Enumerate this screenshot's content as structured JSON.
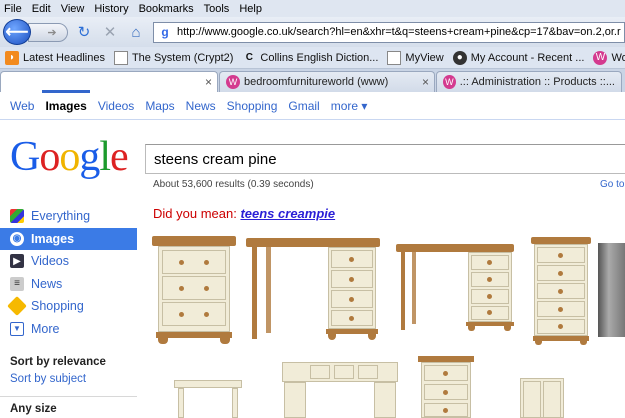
{
  "menu": [
    "File",
    "Edit",
    "View",
    "History",
    "Bookmarks",
    "Tools",
    "Help"
  ],
  "nav": {
    "url": "http://www.google.co.uk/search?hl=en&xhr=t&q=steens+cream+pine&cp=17&bav=on.2,or.r"
  },
  "bookmarks": [
    {
      "label": "Latest Headlines",
      "icon": "rss-icon"
    },
    {
      "label": "The System (Crypt2)",
      "icon": "page-icon"
    },
    {
      "label": "Collins English Diction...",
      "icon": "collins-icon"
    },
    {
      "label": "MyView",
      "icon": "page-icon"
    },
    {
      "label": "My Account - Recent ...",
      "icon": "account-icon"
    },
    {
      "label": "WorldStores",
      "icon": "worldstores-icon"
    }
  ],
  "tabs": [
    {
      "label": ""
    },
    {
      "label": "bedroomfurnitureworld (www)"
    },
    {
      "label": ".:: Administration :: Products ::..."
    }
  ],
  "google_nav": [
    "Web",
    "Images",
    "Videos",
    "Maps",
    "News",
    "Shopping",
    "Gmail",
    "more ▾"
  ],
  "logo": [
    "G",
    "o",
    "o",
    "g",
    "l",
    "e"
  ],
  "search": {
    "query": "steens cream pine",
    "results_text": "About 53,600 results (0.39 seconds)",
    "goto": "Go to"
  },
  "sidebar": [
    {
      "label": "Everything",
      "icon": "everything-icon"
    },
    {
      "label": "Images",
      "icon": "images-icon",
      "selected": true
    },
    {
      "label": "Videos",
      "icon": "videos-icon"
    },
    {
      "label": "News",
      "icon": "news-icon"
    },
    {
      "label": "Shopping",
      "icon": "shopping-icon"
    },
    {
      "label": "More",
      "icon": "more-icon"
    }
  ],
  "sort": {
    "relevance": "Sort by relevance",
    "subject": "Sort by subject",
    "any_size": "Any size"
  },
  "dym": {
    "prefix": "Did you mean:",
    "suggestion": "teens creampie"
  }
}
